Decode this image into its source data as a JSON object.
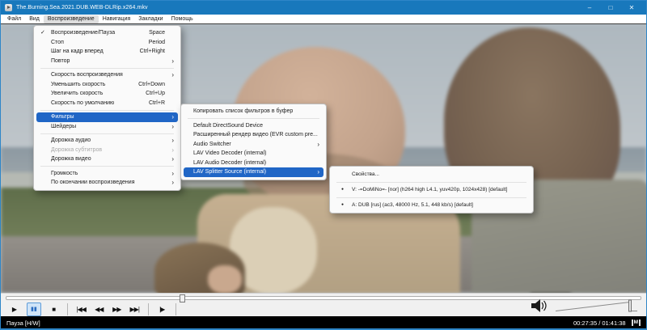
{
  "glyphs": {
    "check": "✓",
    "arrow": "›",
    "bullet": "●"
  },
  "colors": {
    "titlebar": "#1878bc",
    "menu_selection": "#2066c6",
    "pause_active_bg": "#cfe4f8"
  },
  "window": {
    "title": "The.Burning.Sea.2021.DUB.WEB-DLRip.x264.mkv",
    "buttons": [
      {
        "glyph": "–",
        "name": "minimize-button"
      },
      {
        "glyph": "□",
        "name": "maximize-button"
      },
      {
        "glyph": "✕",
        "name": "close-button"
      }
    ]
  },
  "menubar": {
    "items": [
      {
        "label": "Файл",
        "name": "menubar-item-file"
      },
      {
        "label": "Вид",
        "name": "menubar-item-view"
      },
      {
        "label": "Воспроизведение",
        "name": "menubar-item-play",
        "active": true
      },
      {
        "label": "Навигация",
        "name": "menubar-item-navigation"
      },
      {
        "label": "Закладки",
        "name": "menubar-item-bookmarks"
      },
      {
        "label": "Помощь",
        "name": "menubar-item-help"
      }
    ]
  },
  "play_menu": {
    "items": [
      {
        "label": "Воспроизведение/Пауза",
        "shortcut": "Space",
        "checked": true,
        "name": "menu-item-play-pause"
      },
      {
        "label": "Стоп",
        "shortcut": "Period",
        "name": "menu-item-stop"
      },
      {
        "label": "Шаг на кадр вперед",
        "shortcut": "Ctrl+Right",
        "name": "menu-item-frame-step"
      },
      {
        "label": "Повтор",
        "submenu": true,
        "name": "menu-item-repeat"
      },
      {
        "sep": true
      },
      {
        "label": "Скорость воспроизведения",
        "submenu": true,
        "name": "menu-item-playback-rate"
      },
      {
        "label": "Уменьшить скорость",
        "shortcut": "Ctrl+Down",
        "name": "menu-item-decrease-rate"
      },
      {
        "label": "Увеличить скорость",
        "shortcut": "Ctrl+Up",
        "name": "menu-item-increase-rate"
      },
      {
        "label": "Скорость по умолчанию",
        "shortcut": "Ctrl+R",
        "name": "menu-item-reset-rate"
      },
      {
        "sep": true
      },
      {
        "label": "Фильтры",
        "submenu": true,
        "selected": true,
        "name": "menu-item-filters"
      },
      {
        "label": "Шейдеры",
        "submenu": true,
        "name": "menu-item-shaders"
      },
      {
        "sep": true
      },
      {
        "label": "Дорожка аудио",
        "submenu": true,
        "name": "menu-item-audio-track"
      },
      {
        "label": "Дорожка субтитров",
        "submenu": true,
        "disabled": true,
        "name": "menu-item-subtitle-track"
      },
      {
        "label": "Дорожка видео",
        "submenu": true,
        "name": "menu-item-video-track"
      },
      {
        "sep": true
      },
      {
        "label": "Громкость",
        "submenu": true,
        "name": "menu-item-volume"
      },
      {
        "label": "По окончании воспроизведения",
        "submenu": true,
        "name": "menu-item-after-playback"
      }
    ]
  },
  "filters_menu": {
    "items": [
      {
        "label": "Копировать список фильтров в буфер",
        "name": "menu-item-copy-filter-list"
      },
      {
        "sep": true
      },
      {
        "label": "Default DirectSound Device",
        "name": "menu-item-directsound-device"
      },
      {
        "label": "Расширенный рендер видео (EVR custom pre...",
        "name": "menu-item-evr-renderer"
      },
      {
        "label": "Audio Switcher",
        "submenu": true,
        "name": "menu-item-audio-switcher"
      },
      {
        "label": "LAV Video Decoder (internal)",
        "name": "menu-item-lav-video-decoder"
      },
      {
        "label": "LAV Audio Decoder (internal)",
        "name": "menu-item-lav-audio-decoder"
      },
      {
        "label": "LAV Splitter Source (internal)",
        "submenu": true,
        "selected": true,
        "name": "menu-item-lav-splitter-source"
      }
    ]
  },
  "splitter_menu": {
    "items": [
      {
        "label": "Свойства...",
        "name": "menu-item-properties"
      },
      {
        "sep": true
      },
      {
        "label": "V: -=DoMiNo=- [nor] (h264 high L4.1, yuv420p, 1024x428) [default]",
        "bullet": true,
        "name": "menu-item-video-stream"
      },
      {
        "sep": true
      },
      {
        "label": "A: DUB [rus] (ac3, 48000 Hz, 5.1, 448 kb/s) [default]",
        "bullet": true,
        "name": "menu-item-audio-stream"
      }
    ]
  },
  "transport": {
    "seek_percent": 27.3,
    "buttons": [
      {
        "glyph": "▶",
        "name": "play-button"
      },
      {
        "glyph": "▮▮",
        "name": "pause-button",
        "active": true
      },
      {
        "glyph": "■",
        "name": "stop-button"
      },
      {
        "sep": true
      },
      {
        "glyph": "|◀◀",
        "name": "skip-back-button"
      },
      {
        "glyph": "◀◀",
        "name": "decrease-rate-button"
      },
      {
        "glyph": "▶▶",
        "name": "increase-rate-button"
      },
      {
        "glyph": "▶▶|",
        "name": "skip-forward-button"
      },
      {
        "sep": true
      },
      {
        "glyph": "|▶",
        "name": "frame-step-button"
      },
      {
        "sep": true
      }
    ]
  },
  "status": {
    "state": "Пауза [H/W]",
    "time": "00:27:35 / 01:41:38",
    "indicator": "M"
  }
}
